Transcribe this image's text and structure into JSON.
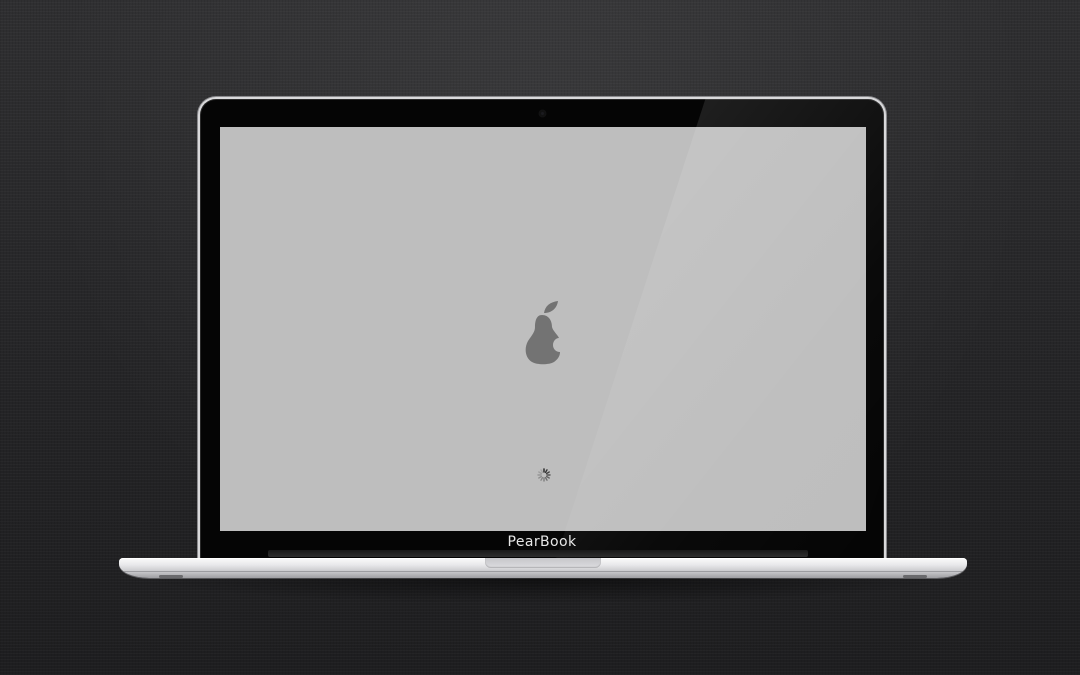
{
  "device": {
    "brand_label": "PearBook",
    "logo_icon": "pear-logo-icon",
    "indicator_icon": "loading-spinner-icon",
    "colors": {
      "screen": "#bebebe",
      "logo": "#737373",
      "bezel": "#050505"
    }
  }
}
